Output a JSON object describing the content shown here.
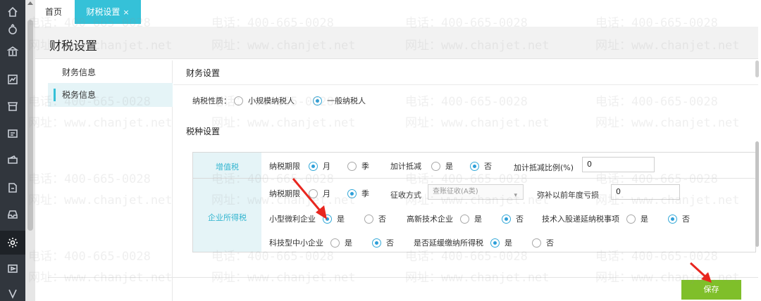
{
  "nav": {
    "home_tab": "首页",
    "current_tab": "财税设置",
    "close_glyph": "×"
  },
  "page": {
    "title": "财税设置"
  },
  "side_nav": {
    "items": [
      "财务信息",
      "税务信息"
    ]
  },
  "finance": {
    "section_title": "财务设置",
    "taxpayer_label": "纳税性质：",
    "option_small": "小规模纳税人",
    "option_general": "一般纳税人"
  },
  "tax": {
    "section_title": "税种设置",
    "vat_label": "增值税",
    "cit_label": "企业所得税",
    "period_label": "纳税期限",
    "month": "月",
    "quarter": "季",
    "yes": "是",
    "no": "否",
    "deduction_label": "加计抵减",
    "deduction_rate_label": "加计抵减比例(%)",
    "deduction_rate_value": "0",
    "collection_label": "征收方式",
    "collection_value": "查账征收(A类)",
    "loss_label": "弥补以前年度亏损",
    "loss_value": "0",
    "small_profit_label": "小型微利企业",
    "high_tech_label": "高新技术企业",
    "tech_equity_label": "技术入股递延纳税事项",
    "tech_sme_label": "科技型中小企业",
    "defer_label": "是否延缓缴纳所得税"
  },
  "actions": {
    "save": "保存"
  },
  "watermark": {
    "phone": "电话：400-665-0028",
    "site": "网址：www.chanjet.net"
  },
  "colors": {
    "accent": "#35c1d8",
    "save": "#7fbf2a",
    "annotation": "#e8261f"
  }
}
